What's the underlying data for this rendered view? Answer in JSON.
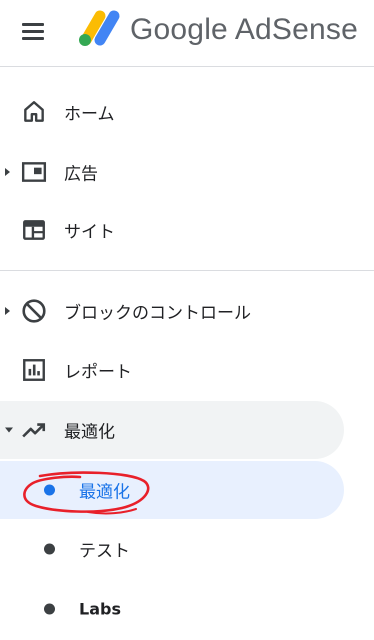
{
  "header": {
    "product_name": "Google AdSense"
  },
  "nav": {
    "home": "ホーム",
    "ads": "広告",
    "sites": "サイト",
    "blocking": "ブロックのコントロール",
    "reports": "レポート",
    "optimization": "最適化",
    "optimization_sub": "最適化",
    "experiments": "テスト",
    "labs": "Labs"
  },
  "colors": {
    "accent": "#1a73e8",
    "active_bg": "#e8f0fe",
    "expanded_bg": "#f1f3f4",
    "annotation": "#e8202a"
  }
}
